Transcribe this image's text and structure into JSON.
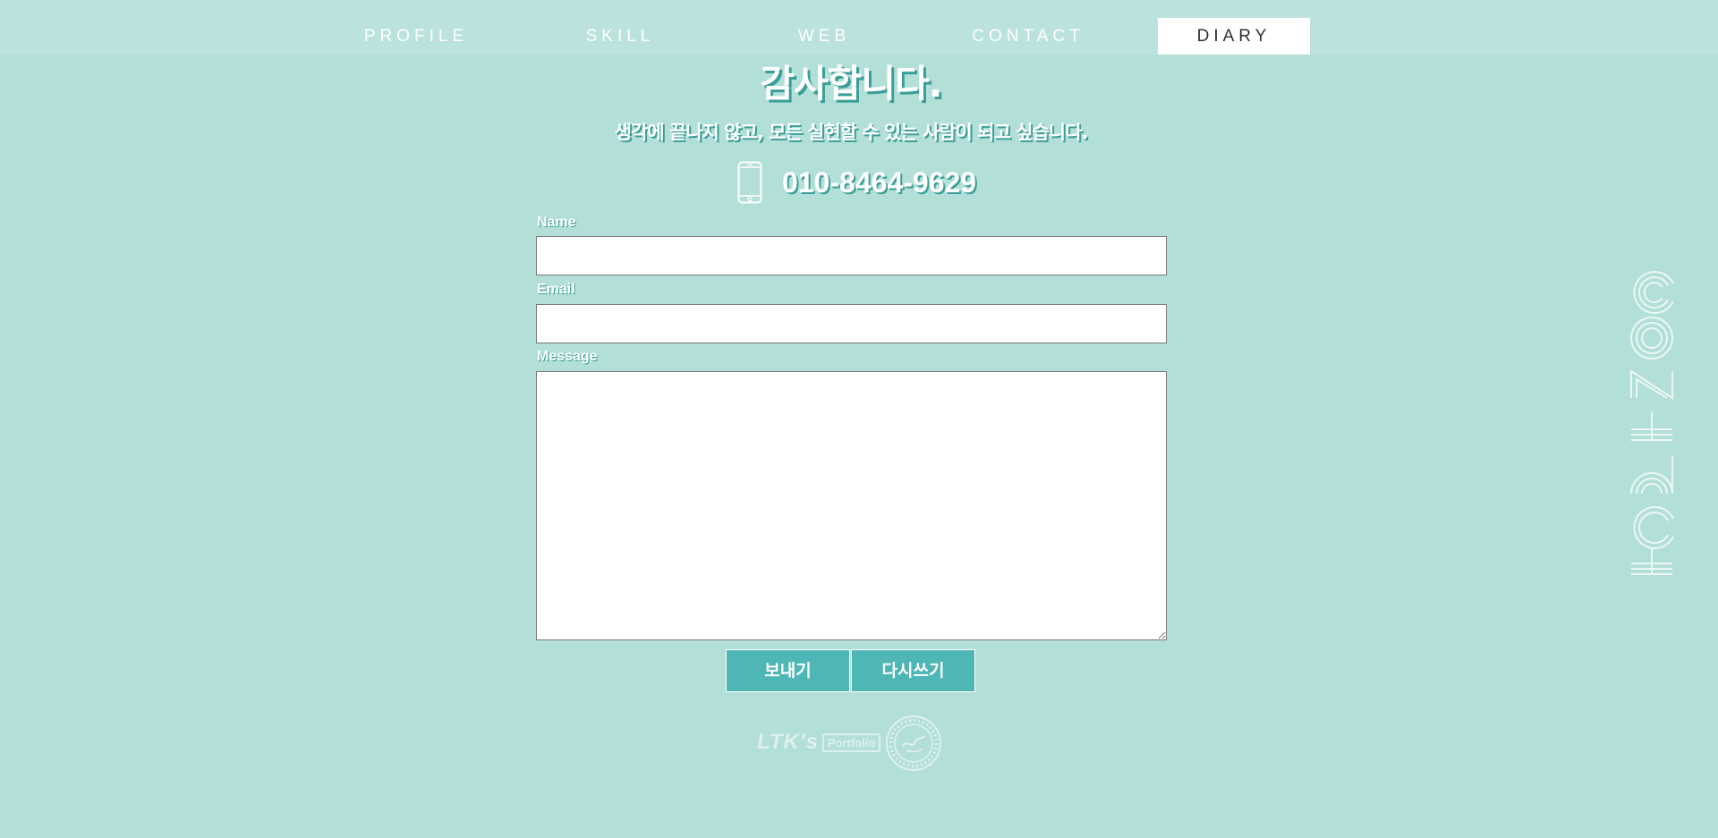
{
  "nav": {
    "items": [
      {
        "label": "PROFILE"
      },
      {
        "label": "SKILL"
      },
      {
        "label": "WEB"
      },
      {
        "label": "CONTACT"
      },
      {
        "label": "DIARY",
        "active": true
      }
    ]
  },
  "hero": {
    "title": "감사합니다.",
    "subtitle": "생각에 끝나지 않고, 모든 실현할 수 있는 사람이 되고 싶습니다.",
    "phone_icon": "smartphone-icon",
    "phone": "010-8464-9629"
  },
  "form": {
    "name_label": "Name",
    "name_value": "",
    "email_label": "Email",
    "email_value": "",
    "message_label": "Message",
    "message_value": "",
    "send_label": "보내기",
    "reset_label": "다시쓰기"
  },
  "footer": {
    "logo_main": "LTK's",
    "logo_sub": "Portfolio",
    "seal_icon": "circular-seal-icon"
  },
  "side": {
    "vertical_word": "CONTACT"
  },
  "colors": {
    "background": "#b2dfd8",
    "navbar": "#bbe2dc",
    "accent": "#4fb6b6",
    "text_shadow": "#3a9e98"
  }
}
